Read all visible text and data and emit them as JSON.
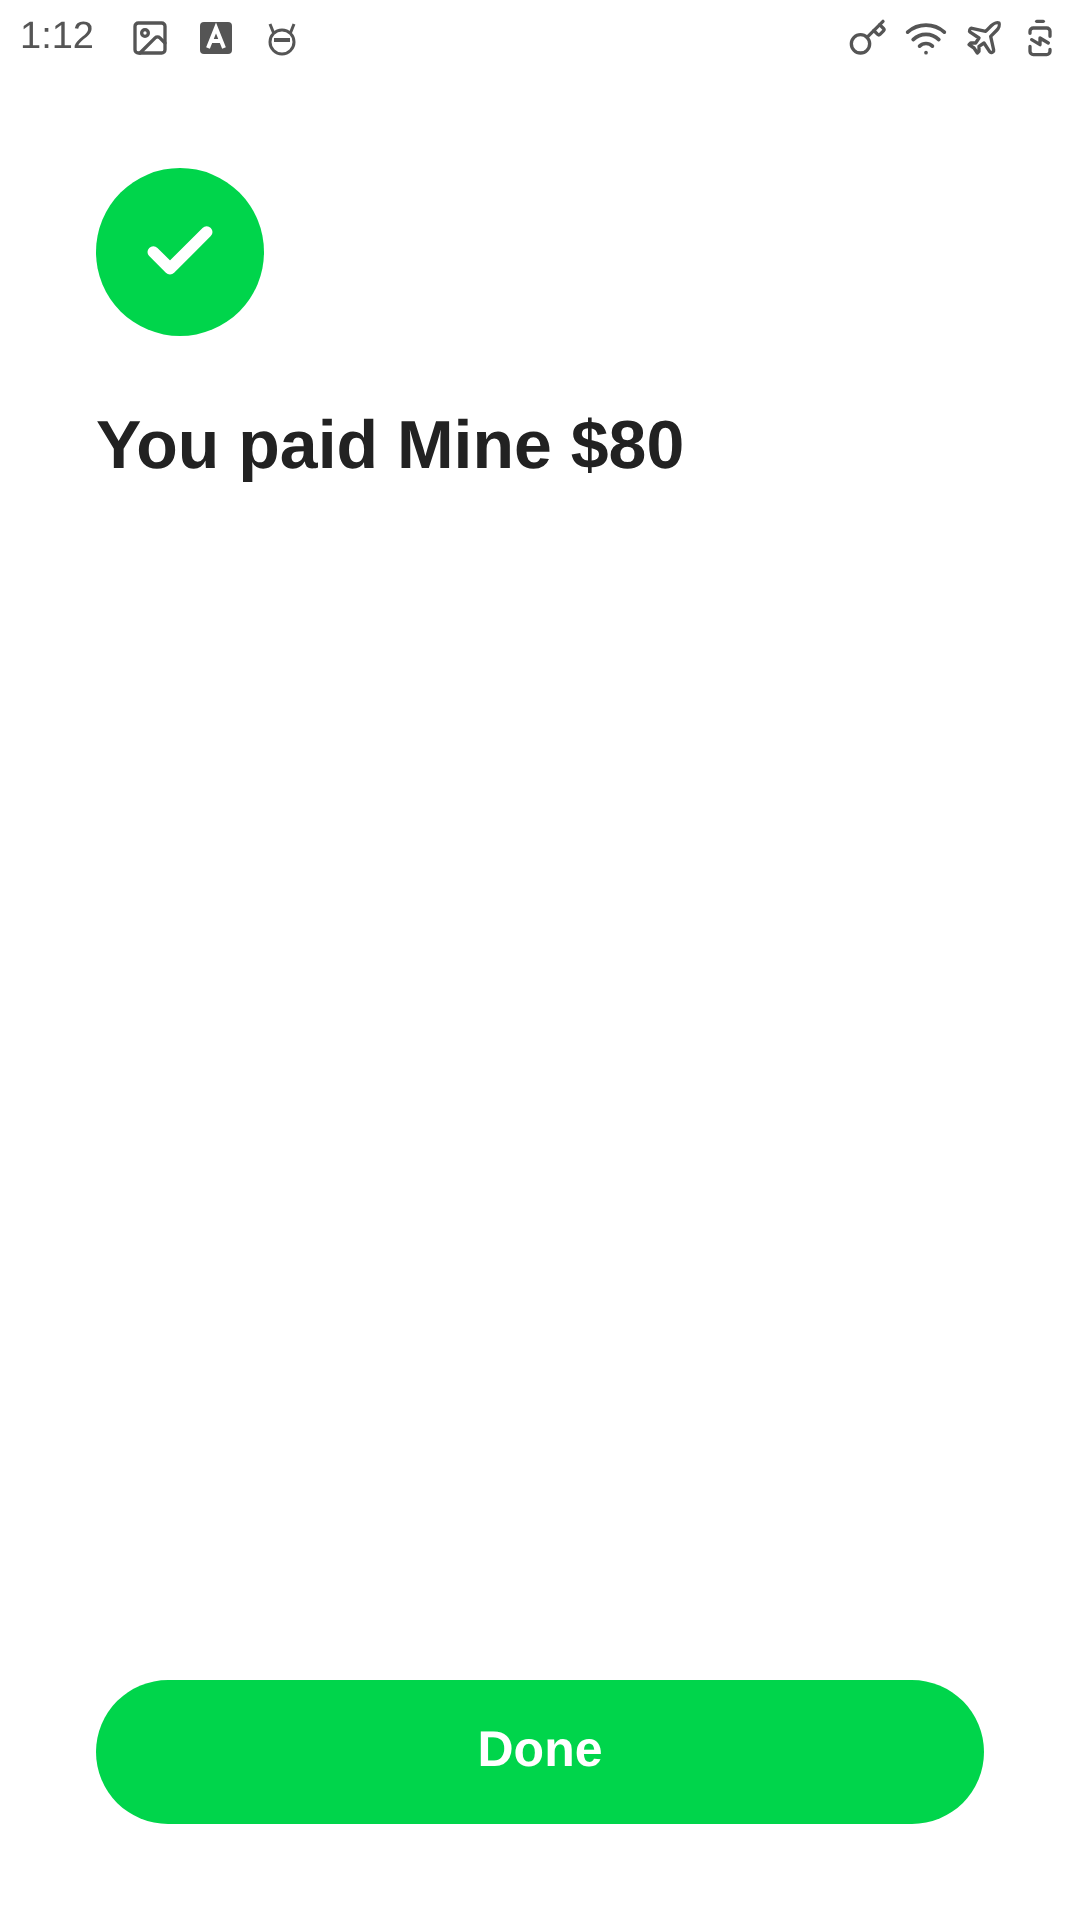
{
  "status_bar": {
    "time": "1:12"
  },
  "message": "You paid Mine $80",
  "done_button": {
    "label": "Done"
  }
}
